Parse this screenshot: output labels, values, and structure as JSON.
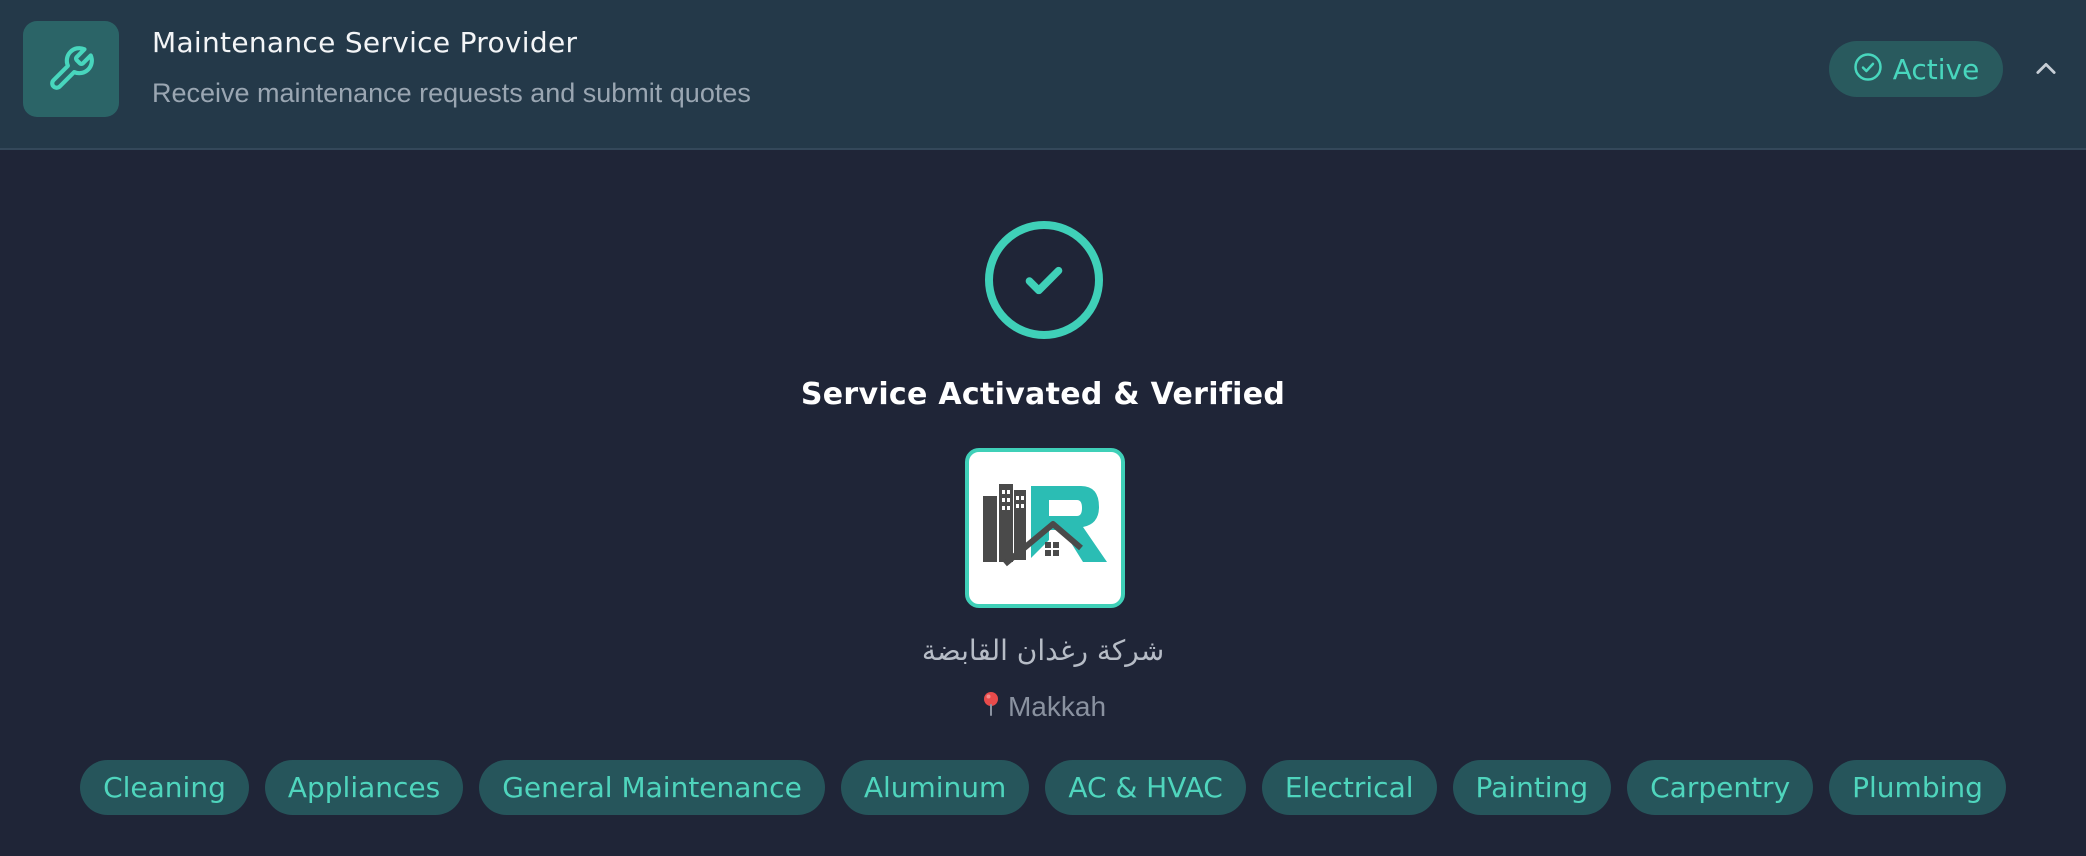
{
  "header": {
    "icon": "wrench-icon",
    "title": "Maintenance Service Provider",
    "subtitle": "Receive maintenance requests and submit quotes",
    "status_label": "Active",
    "status_icon": "check-circle-icon",
    "collapse_icon": "chevron-up-icon"
  },
  "main": {
    "verified_icon": "check-circle-icon",
    "verified_title": "Service Activated & Verified",
    "company_logo": "company-logo",
    "company_name": "شركة رغدان القابضة",
    "location_icon": "pin-icon",
    "location": "Makkah",
    "tags": [
      "Cleaning",
      "Appliances",
      "General Maintenance",
      "Aluminum",
      "AC & HVAC",
      "Electrical",
      "Painting",
      "Carpentry",
      "Plumbing"
    ]
  },
  "colors": {
    "background": "#1f2537",
    "header_background": "#243949",
    "accent": "#3fd0b8",
    "tag_background": "#26555b",
    "logo_teal": "#2bbdb4",
    "logo_dark": "#4a4a4a"
  }
}
